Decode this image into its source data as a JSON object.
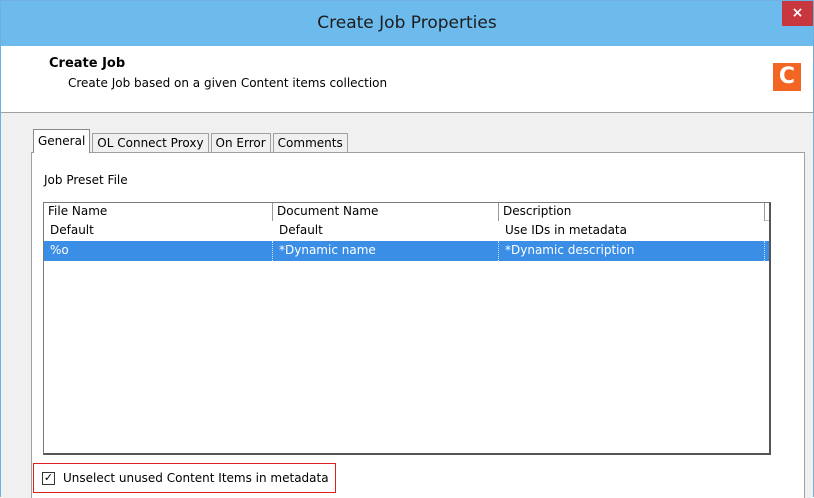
{
  "window": {
    "title": "Create Job Properties",
    "close_label": "×"
  },
  "header": {
    "title": "Create Job",
    "subtitle": "Create Job based on a given Content items collection",
    "logo_letter": "C",
    "logo_color": "#f26522"
  },
  "tabs": [
    {
      "label": "General",
      "active": true
    },
    {
      "label": "OL Connect Proxy",
      "active": false
    },
    {
      "label": "On Error",
      "active": false
    },
    {
      "label": "Comments",
      "active": false
    }
  ],
  "general": {
    "section_label": "Job Preset File",
    "columns": [
      "File Name",
      "Document Name",
      "Description"
    ],
    "rows": [
      {
        "file": "Default",
        "document": "Default",
        "description": "Use IDs in metadata",
        "selected": false
      },
      {
        "file": "%o",
        "document": "*Dynamic name",
        "description": "*Dynamic description",
        "selected": true
      }
    ],
    "checkbox": {
      "label": "Unselect unused Content Items in metadata",
      "checked": true,
      "mark": "✓"
    }
  },
  "colors": {
    "titlebar": "#6dbbec",
    "close": "#c7373d",
    "selection": "#3a8ee6",
    "highlight_border": "#e02020"
  }
}
